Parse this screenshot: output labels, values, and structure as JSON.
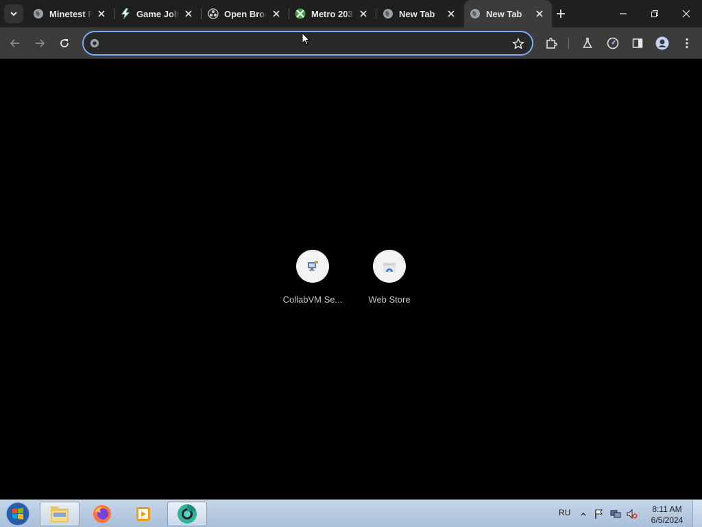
{
  "browser": {
    "tabs": [
      {
        "title": "Minetest F",
        "icon": "globe-icon"
      },
      {
        "title": "Game Jolt",
        "icon": "gamejolt-icon"
      },
      {
        "title": "Open Broa",
        "icon": "obs-icon"
      },
      {
        "title": "Metro 203",
        "icon": "xbox-icon"
      },
      {
        "title": "New Tab",
        "icon": "globe-icon"
      },
      {
        "title": "New Tab",
        "icon": "globe-icon",
        "active": true
      }
    ],
    "omnibox": {
      "value": "",
      "placeholder": ""
    },
    "shortcuts": [
      {
        "label": "CollabVM Se...",
        "icon": "collabvm-icon"
      },
      {
        "label": "Web Store",
        "icon": "web-store-icon"
      }
    ],
    "colors": {
      "omnibox_border": "#7cacf8",
      "tabstrip": "#1f1f1f",
      "toolbar": "#3c3c3c"
    }
  },
  "taskbar": {
    "apps": [
      "explorer-icon",
      "firefox-icon",
      "media-player-icon",
      "chrome-icon"
    ],
    "language": "RU",
    "time": "8:11 AM",
    "date": "6/5/2024"
  }
}
